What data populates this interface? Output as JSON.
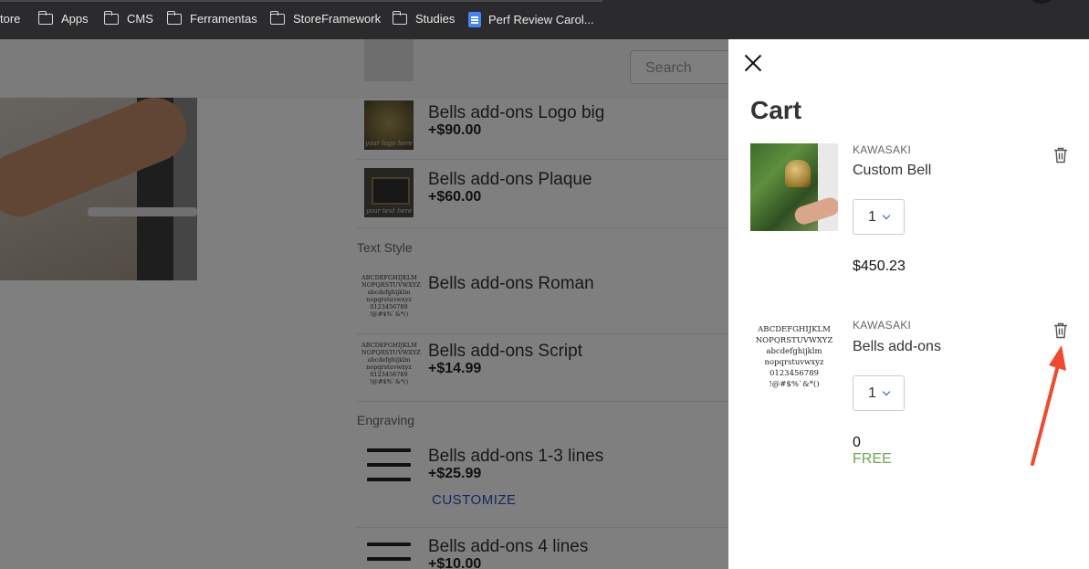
{
  "bookmarks": {
    "items": [
      {
        "label": "tore",
        "icon": "none"
      },
      {
        "label": "Apps",
        "icon": "folder-icon"
      },
      {
        "label": "CMS",
        "icon": "folder-icon"
      },
      {
        "label": "Ferramentas",
        "icon": "folder-icon"
      },
      {
        "label": "StoreFramework",
        "icon": "folder-icon"
      },
      {
        "label": "Studies",
        "icon": "folder-icon"
      },
      {
        "label": "Perf Review Carol...",
        "icon": "google-doc-icon"
      }
    ]
  },
  "store": {
    "search_placeholder": "Search",
    "addons": [
      {
        "name": "Bells add-ons Logo big",
        "price": "+$90.00",
        "image_caption": "your logo here"
      },
      {
        "name": "Bells add-ons Plaque",
        "price": "+$60.00",
        "image_caption": "your text here"
      },
      {
        "name": "Bells add-ons Roman",
        "price": ""
      },
      {
        "name": "Bells add-ons Script",
        "price": "+$14.99"
      },
      {
        "name": "Bells add-ons 1-3 lines",
        "price": "+$25.99",
        "action": "CUSTOMIZE"
      },
      {
        "name": "Bells add-ons 4 lines",
        "price": "+$10.00"
      }
    ],
    "sections": {
      "text_style": "Text Style",
      "engraving": "Engraving"
    },
    "font_sample_lines": [
      "ABCDEFGHIJKLM",
      "NOPQRSTUVWXYZ",
      "abcdefghijklm",
      "nopqrstuvwxyz",
      "0123456789",
      "!@#$%`&*()"
    ]
  },
  "cart": {
    "title": "Cart",
    "items": [
      {
        "brand": "KAWASAKI",
        "name": "Custom Bell",
        "quantity": "1",
        "price": "$450.23"
      },
      {
        "brand": "KAWASAKI",
        "name": "Bells add-ons",
        "quantity": "1",
        "price": "0",
        "price_note": "FREE"
      }
    ],
    "font_image_lines": [
      "ABCDEFGHIJKLM",
      "NOPQRSTUVWXYZ",
      "abcdefghijklm",
      "nopqrstuvwxyz",
      "0123456789",
      "!@#$%`&*()"
    ]
  },
  "colors": {
    "accent_blue": "#2a4fc8",
    "free_green": "#6aa84f",
    "annotation_arrow": "#f04a2e"
  }
}
